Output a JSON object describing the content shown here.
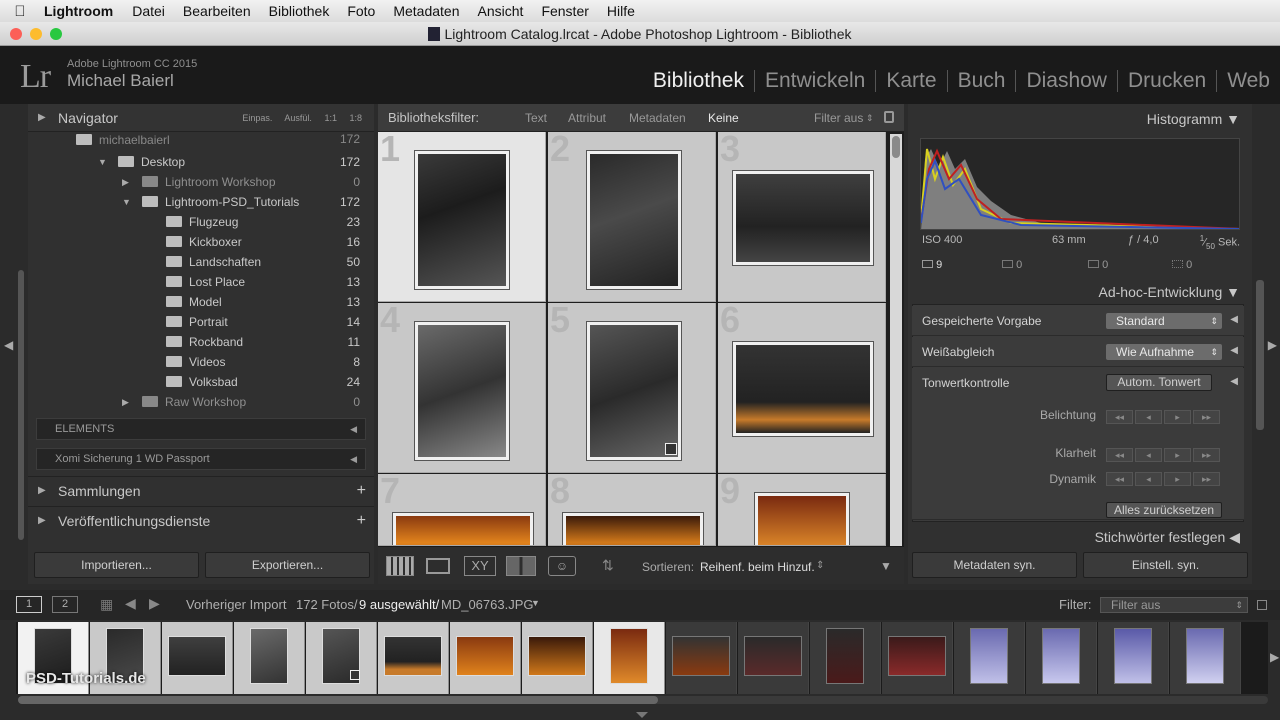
{
  "menubar": {
    "apple": "",
    "app": "Lightroom",
    "items": [
      "Datei",
      "Bearbeiten",
      "Bibliothek",
      "Foto",
      "Metadaten",
      "Ansicht",
      "Fenster",
      "Hilfe"
    ]
  },
  "window_title": "Lightroom Catalog.lrcat - Adobe Photoshop Lightroom - Bibliothek",
  "identity": {
    "logo": "Lr",
    "product": "Adobe Lightroom CC 2015",
    "user": "Michael Baierl"
  },
  "modules": [
    "Bibliothek",
    "Entwickeln",
    "Karte",
    "Buch",
    "Diashow",
    "Drucken",
    "Web"
  ],
  "navigator": {
    "title": "Navigator",
    "zoom": [
      "Einpas.",
      "Ausfül.",
      "1:1",
      "1:8"
    ]
  },
  "folders": [
    {
      "name": "michaelbaierl",
      "count": "172"
    },
    {
      "name": "Desktop",
      "count": "172"
    },
    {
      "name": "Lightroom Workshop",
      "count": "0"
    },
    {
      "name": "Lightroom-PSD_Tutorials",
      "count": "172"
    },
    {
      "name": "Flugzeug",
      "count": "23"
    },
    {
      "name": "Kickboxer",
      "count": "16"
    },
    {
      "name": "Landschaften",
      "count": "50"
    },
    {
      "name": "Lost Place",
      "count": "13"
    },
    {
      "name": "Model",
      "count": "13"
    },
    {
      "name": "Portrait",
      "count": "14"
    },
    {
      "name": "Rockband",
      "count": "11"
    },
    {
      "name": "Videos",
      "count": "8"
    },
    {
      "name": "Volksbad",
      "count": "24"
    },
    {
      "name": "Raw Workshop",
      "count": "0"
    }
  ],
  "volumes": [
    "ELEMENTS",
    "Xomi Sicherung 1 WD Passport"
  ],
  "collections": "Sammlungen",
  "publish": "Veröffentlichungsdienste",
  "import_label": "Importieren...",
  "export_label": "Exportieren...",
  "filterbar": {
    "label": "Bibliotheksfilter:",
    "options": [
      "Text",
      "Attribut",
      "Metadaten",
      "Keine"
    ],
    "status": "Filter aus"
  },
  "grid_numbers": [
    "1",
    "2",
    "3",
    "4",
    "5",
    "6",
    "7",
    "8",
    "9"
  ],
  "histogram": {
    "title": "Histogramm",
    "iso": "ISO 400",
    "focal": "63 mm",
    "aperture": "ƒ / 4,0",
    "shutter_num": "1",
    "shutter_den": "50",
    "shutter_unit": "Sek.",
    "counts": [
      "9",
      "0",
      "0",
      "0"
    ]
  },
  "quick_develop": {
    "title": "Ad-hoc-Entwicklung",
    "preset_label": "Gespeicherte Vorgabe",
    "preset_value": "Standard",
    "wb_label": "Weißabgleich",
    "wb_value": "Wie Aufnahme",
    "tone_label": "Tonwertkontrolle",
    "auto_label": "Autom. Tonwert",
    "exposure": "Belichtung",
    "clarity": "Klarheit",
    "vibrance": "Dynamik",
    "reset": "Alles zurücksetzen",
    "step_glyphs": [
      "◂◂",
      "◂",
      "▸",
      "▸▸"
    ]
  },
  "keywording": "Stichwörter festlegen",
  "sync_meta": "Metadaten syn.",
  "sync_settings": "Einstell. syn.",
  "toolbar": {
    "sort_label": "Sortieren:",
    "sort_value": "Reihenf. beim Hinzuf."
  },
  "filmhdr": {
    "screen1": "1",
    "screen2": "2",
    "source": "Vorheriger Import",
    "count": "172 Fotos/",
    "selected": "9 ausgewählt/",
    "file": "MD_06763.JPG",
    "filter_label": "Filter:",
    "filter_value": "Filter aus"
  },
  "watermark": "PSD-Tutorials.de"
}
